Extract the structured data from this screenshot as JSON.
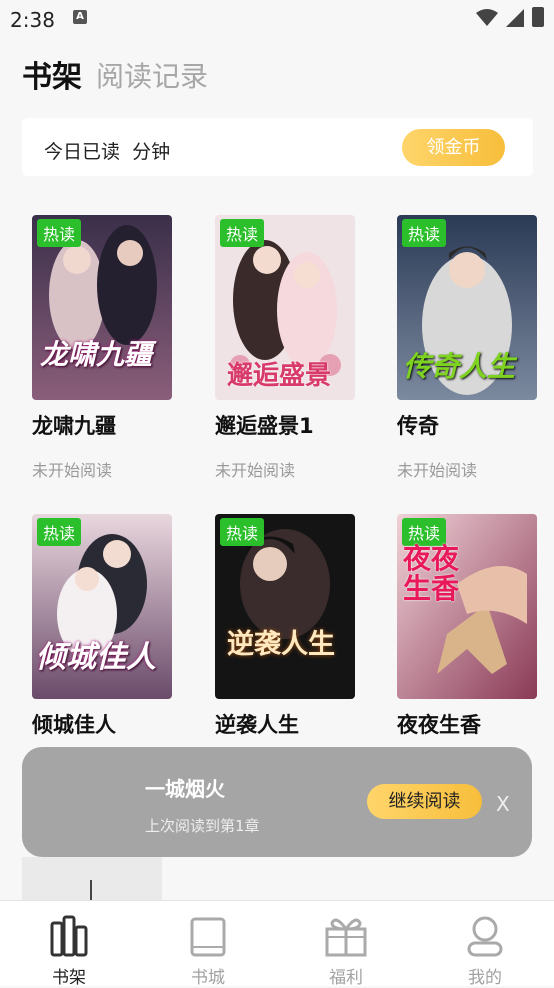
{
  "status_bar": {
    "time": "2:38",
    "notification_icon": "A"
  },
  "tabs": {
    "shelf": "书架",
    "history": "阅读记录"
  },
  "daily": {
    "text": "今日已读  分钟",
    "coin_button": "领金币"
  },
  "books": [
    {
      "title": "龙啸九疆",
      "status": "未开始阅读",
      "badge": "热读",
      "cover_text": "龙啸九疆"
    },
    {
      "title": "邂逅盛景1",
      "status": "未开始阅读",
      "badge": "热读",
      "cover_text": "邂逅盛景"
    },
    {
      "title": "传奇",
      "status": "未开始阅读",
      "badge": "热读",
      "cover_text": "传奇人生"
    },
    {
      "title": "倾城佳人",
      "badge": "热读",
      "cover_text": "倾城佳人"
    },
    {
      "title": "逆袭人生",
      "badge": "热读",
      "cover_text": "逆袭人生"
    },
    {
      "title": "夜夜生香",
      "badge": "热读",
      "cover_text": "夜夜生香"
    }
  ],
  "continue": {
    "title": "一城烟火",
    "subtitle": "上次阅读到第1章",
    "button": "继续阅读",
    "close": "X"
  },
  "nav": [
    {
      "label": "书架",
      "icon": "bookshelf-icon"
    },
    {
      "label": "书城",
      "icon": "book-icon"
    },
    {
      "label": "福利",
      "icon": "gift-icon"
    },
    {
      "label": "我的",
      "icon": "user-icon"
    }
  ],
  "colors": {
    "accent_yellow": "#f7be3b",
    "badge_green": "#2bbf2b"
  }
}
